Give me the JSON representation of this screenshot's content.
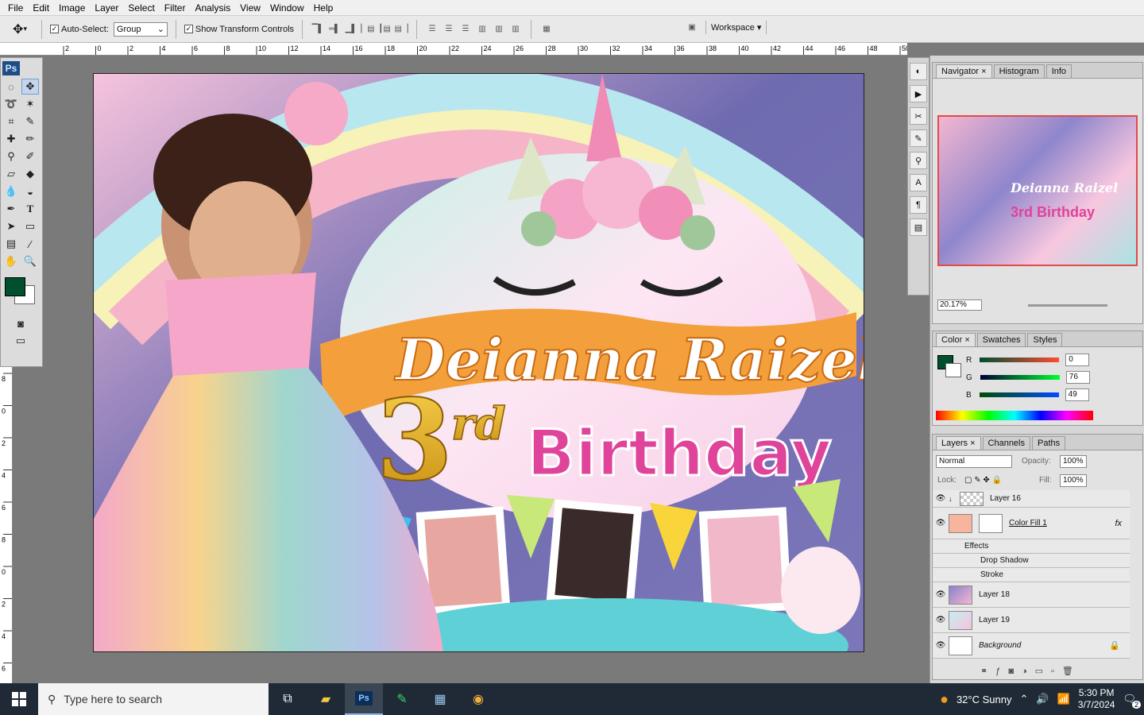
{
  "menu": [
    "File",
    "Edit",
    "Image",
    "Layer",
    "Select",
    "Filter",
    "Analysis",
    "View",
    "Window",
    "Help"
  ],
  "options": {
    "auto_select_label": "Auto-Select:",
    "auto_select_value": "Group",
    "show_transform_label": "Show Transform Controls",
    "workspace_label": "Workspace ▾"
  },
  "ruler": {
    "h_ticks": [
      "2",
      "0",
      "2",
      "4",
      "6",
      "8",
      "10",
      "12",
      "14",
      "16",
      "18",
      "20",
      "22",
      "24",
      "26",
      "28",
      "30",
      "32",
      "34",
      "36",
      "38",
      "40",
      "42",
      "44",
      "46",
      "48",
      "50"
    ],
    "v_ticks": [
      "8",
      "0",
      "2",
      "4",
      "6",
      "8",
      "0",
      "2",
      "4",
      "6"
    ]
  },
  "tools": {
    "logo": "Ps"
  },
  "document": {
    "name_line1": "Deianna Raizel",
    "ordinal_number": "3",
    "ordinal_suffix": "rd",
    "birthday_word": "Birthday"
  },
  "panels": {
    "navigator_tabs": [
      "Navigator",
      "Histogram",
      "Info"
    ],
    "navigator_zoom": "20.17%",
    "nav_thumb_line1": "Deianna Raizel",
    "nav_thumb_line2": "3rd Birthday",
    "color_tabs": [
      "Color",
      "Swatches",
      "Styles"
    ],
    "color_fg": "#00502f",
    "rgb": [
      {
        "label": "R",
        "value": "0",
        "grad": "linear-gradient(90deg,#004c31,#ff4c31)"
      },
      {
        "label": "G",
        "value": "76",
        "grad": "linear-gradient(90deg,#000031,#00ff31)"
      },
      {
        "label": "B",
        "value": "49",
        "grad": "linear-gradient(90deg,#004c00,#004cff)"
      }
    ],
    "layers_tabs": [
      "Layers",
      "Channels",
      "Paths"
    ],
    "blend_mode": "Normal",
    "opacity_label": "Opacity:",
    "opacity_value": "100%",
    "lock_label": "Lock:",
    "fill_label": "Fill:",
    "fill_value": "100%",
    "layers": [
      {
        "name": "Layer 16"
      },
      {
        "name": "Color Fill 1"
      },
      {
        "name": "Effects"
      },
      {
        "name": "Drop Shadow"
      },
      {
        "name": "Stroke"
      },
      {
        "name": "Layer 18"
      },
      {
        "name": "Layer 19"
      },
      {
        "name": "Background"
      }
    ]
  },
  "taskbar": {
    "search_placeholder": "Type here to search",
    "weather": "32°C  Sunny",
    "time": "5:30 PM",
    "date": "3/7/2024",
    "notif_count": "2"
  }
}
